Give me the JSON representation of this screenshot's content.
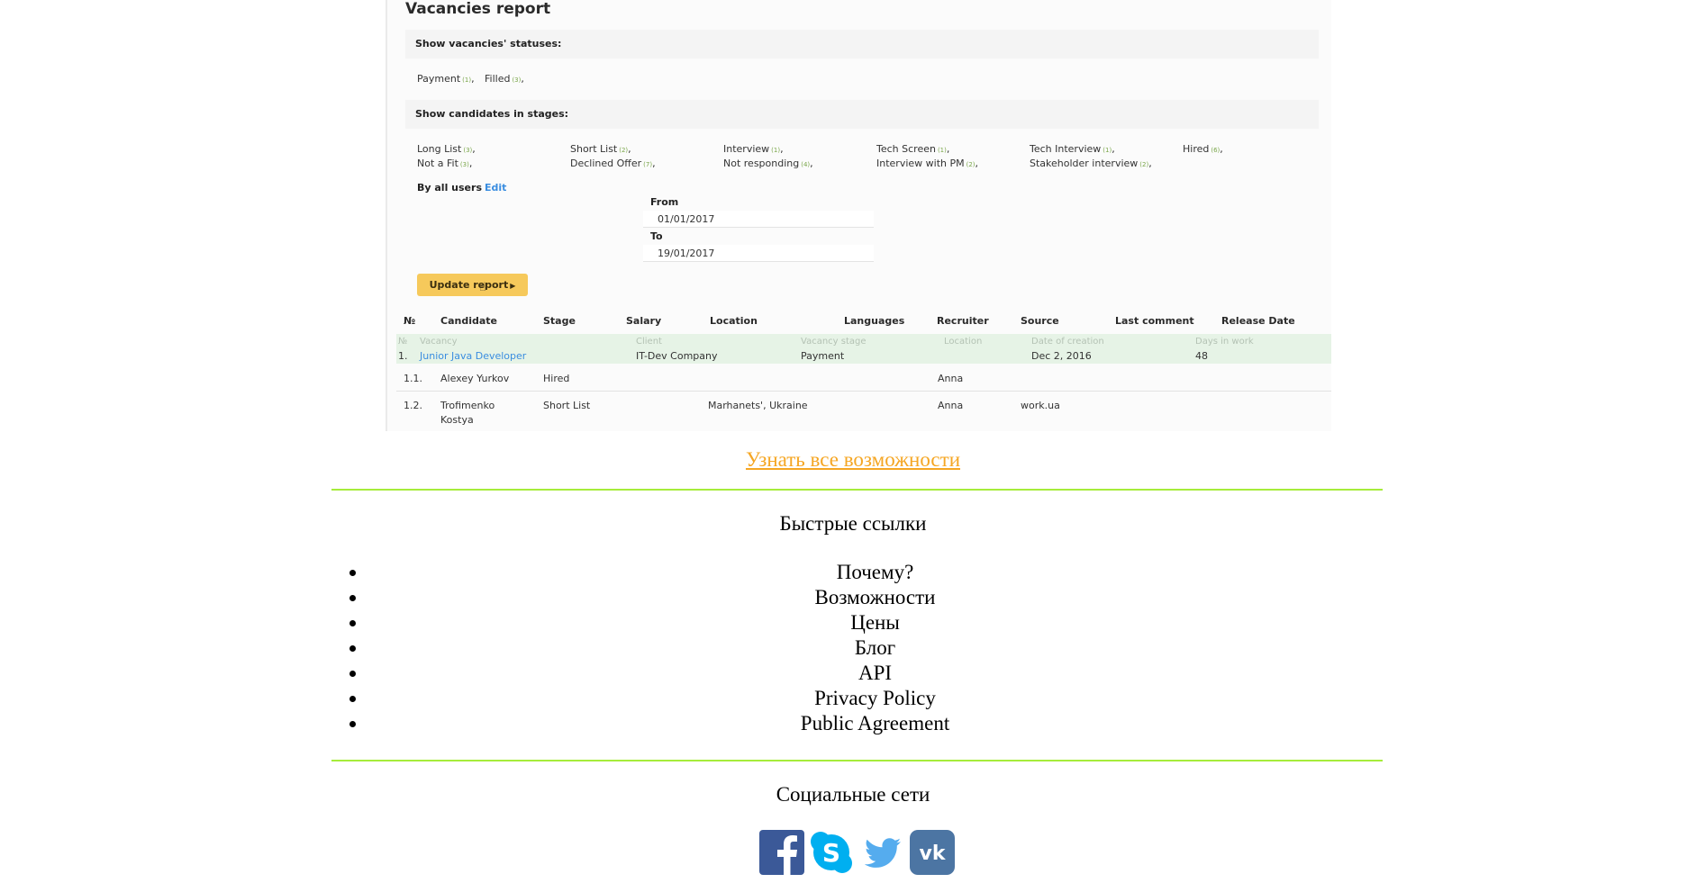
{
  "report": {
    "title": "Vacancies report",
    "statuses_title": "Show vacancies' statuses:",
    "statuses": [
      {
        "label": "Payment",
        "count": "(1)"
      },
      {
        "label": "Filled",
        "count": "(3)"
      }
    ],
    "stages_title": "Show candidates in stages:",
    "stages": [
      {
        "label": "Long List",
        "count": "(3)"
      },
      {
        "label": "Short List",
        "count": "(2)"
      },
      {
        "label": "Interview",
        "count": "(1)"
      },
      {
        "label": "Tech Screen",
        "count": "(1)"
      },
      {
        "label": "Tech Interview",
        "count": "(1)"
      },
      {
        "label": "Hired",
        "count": "(6)"
      },
      {
        "label": "Not a Fit",
        "count": "(3)"
      },
      {
        "label": "Declined Offer",
        "count": "(7)"
      },
      {
        "label": "Not responding",
        "count": "(4)"
      },
      {
        "label": "Interview with PM",
        "count": "(2)"
      },
      {
        "label": "Stakeholder interview",
        "count": "(2)"
      }
    ],
    "by_all_users": "By all users",
    "edit_label": "Edit",
    "from_label": "From",
    "from_value": "01/01/2017",
    "to_label": "To",
    "to_value": "19/01/2017",
    "update_button": "Update report",
    "table_headers": [
      "№",
      "Candidate",
      "Stage",
      "Salary",
      "Location",
      "Languages",
      "Recruiter",
      "Source",
      "Last comment",
      "Release Date"
    ],
    "vacancy_subheaders": [
      "№",
      "Vacancy",
      "Client",
      "Vacancy stage",
      "Location",
      "Date of creation",
      "Days in work"
    ],
    "vacancy": {
      "num": "1.",
      "name": "Junior Java Developer",
      "client": "IT-Dev Company",
      "stage": "Payment",
      "date": "Dec 2, 2016",
      "days": "48"
    },
    "candidates": [
      {
        "num": "1.1.",
        "name": "Alexey Yurkov",
        "name2": "",
        "stage": "Hired",
        "location": "",
        "recruiter": "Anna",
        "source": ""
      },
      {
        "num": "1.2.",
        "name": "Trofimenko",
        "name2": "Kostya",
        "stage": "Short List",
        "location": "Marhanets', Ukraine",
        "recruiter": "Anna",
        "source": "work.ua"
      }
    ]
  },
  "learn_more": "Узнать все возможности",
  "quick_links": {
    "title": "Быстрые ссылки",
    "items": [
      "Почему?",
      "Возможности",
      "Цены",
      "Блог",
      "API",
      "Privacy Policy",
      "Public Agreement"
    ]
  },
  "social": {
    "title": "Социальные сети",
    "icons": [
      "facebook-icon",
      "skype-icon",
      "twitter-icon",
      "vk-icon"
    ]
  },
  "colors": {
    "accent_link": "#f5a623",
    "divider": "#a6ec3b",
    "update_button": "#f6c95b",
    "vacancy_row": "#e6f3e6",
    "report_link": "#3a8de0"
  }
}
